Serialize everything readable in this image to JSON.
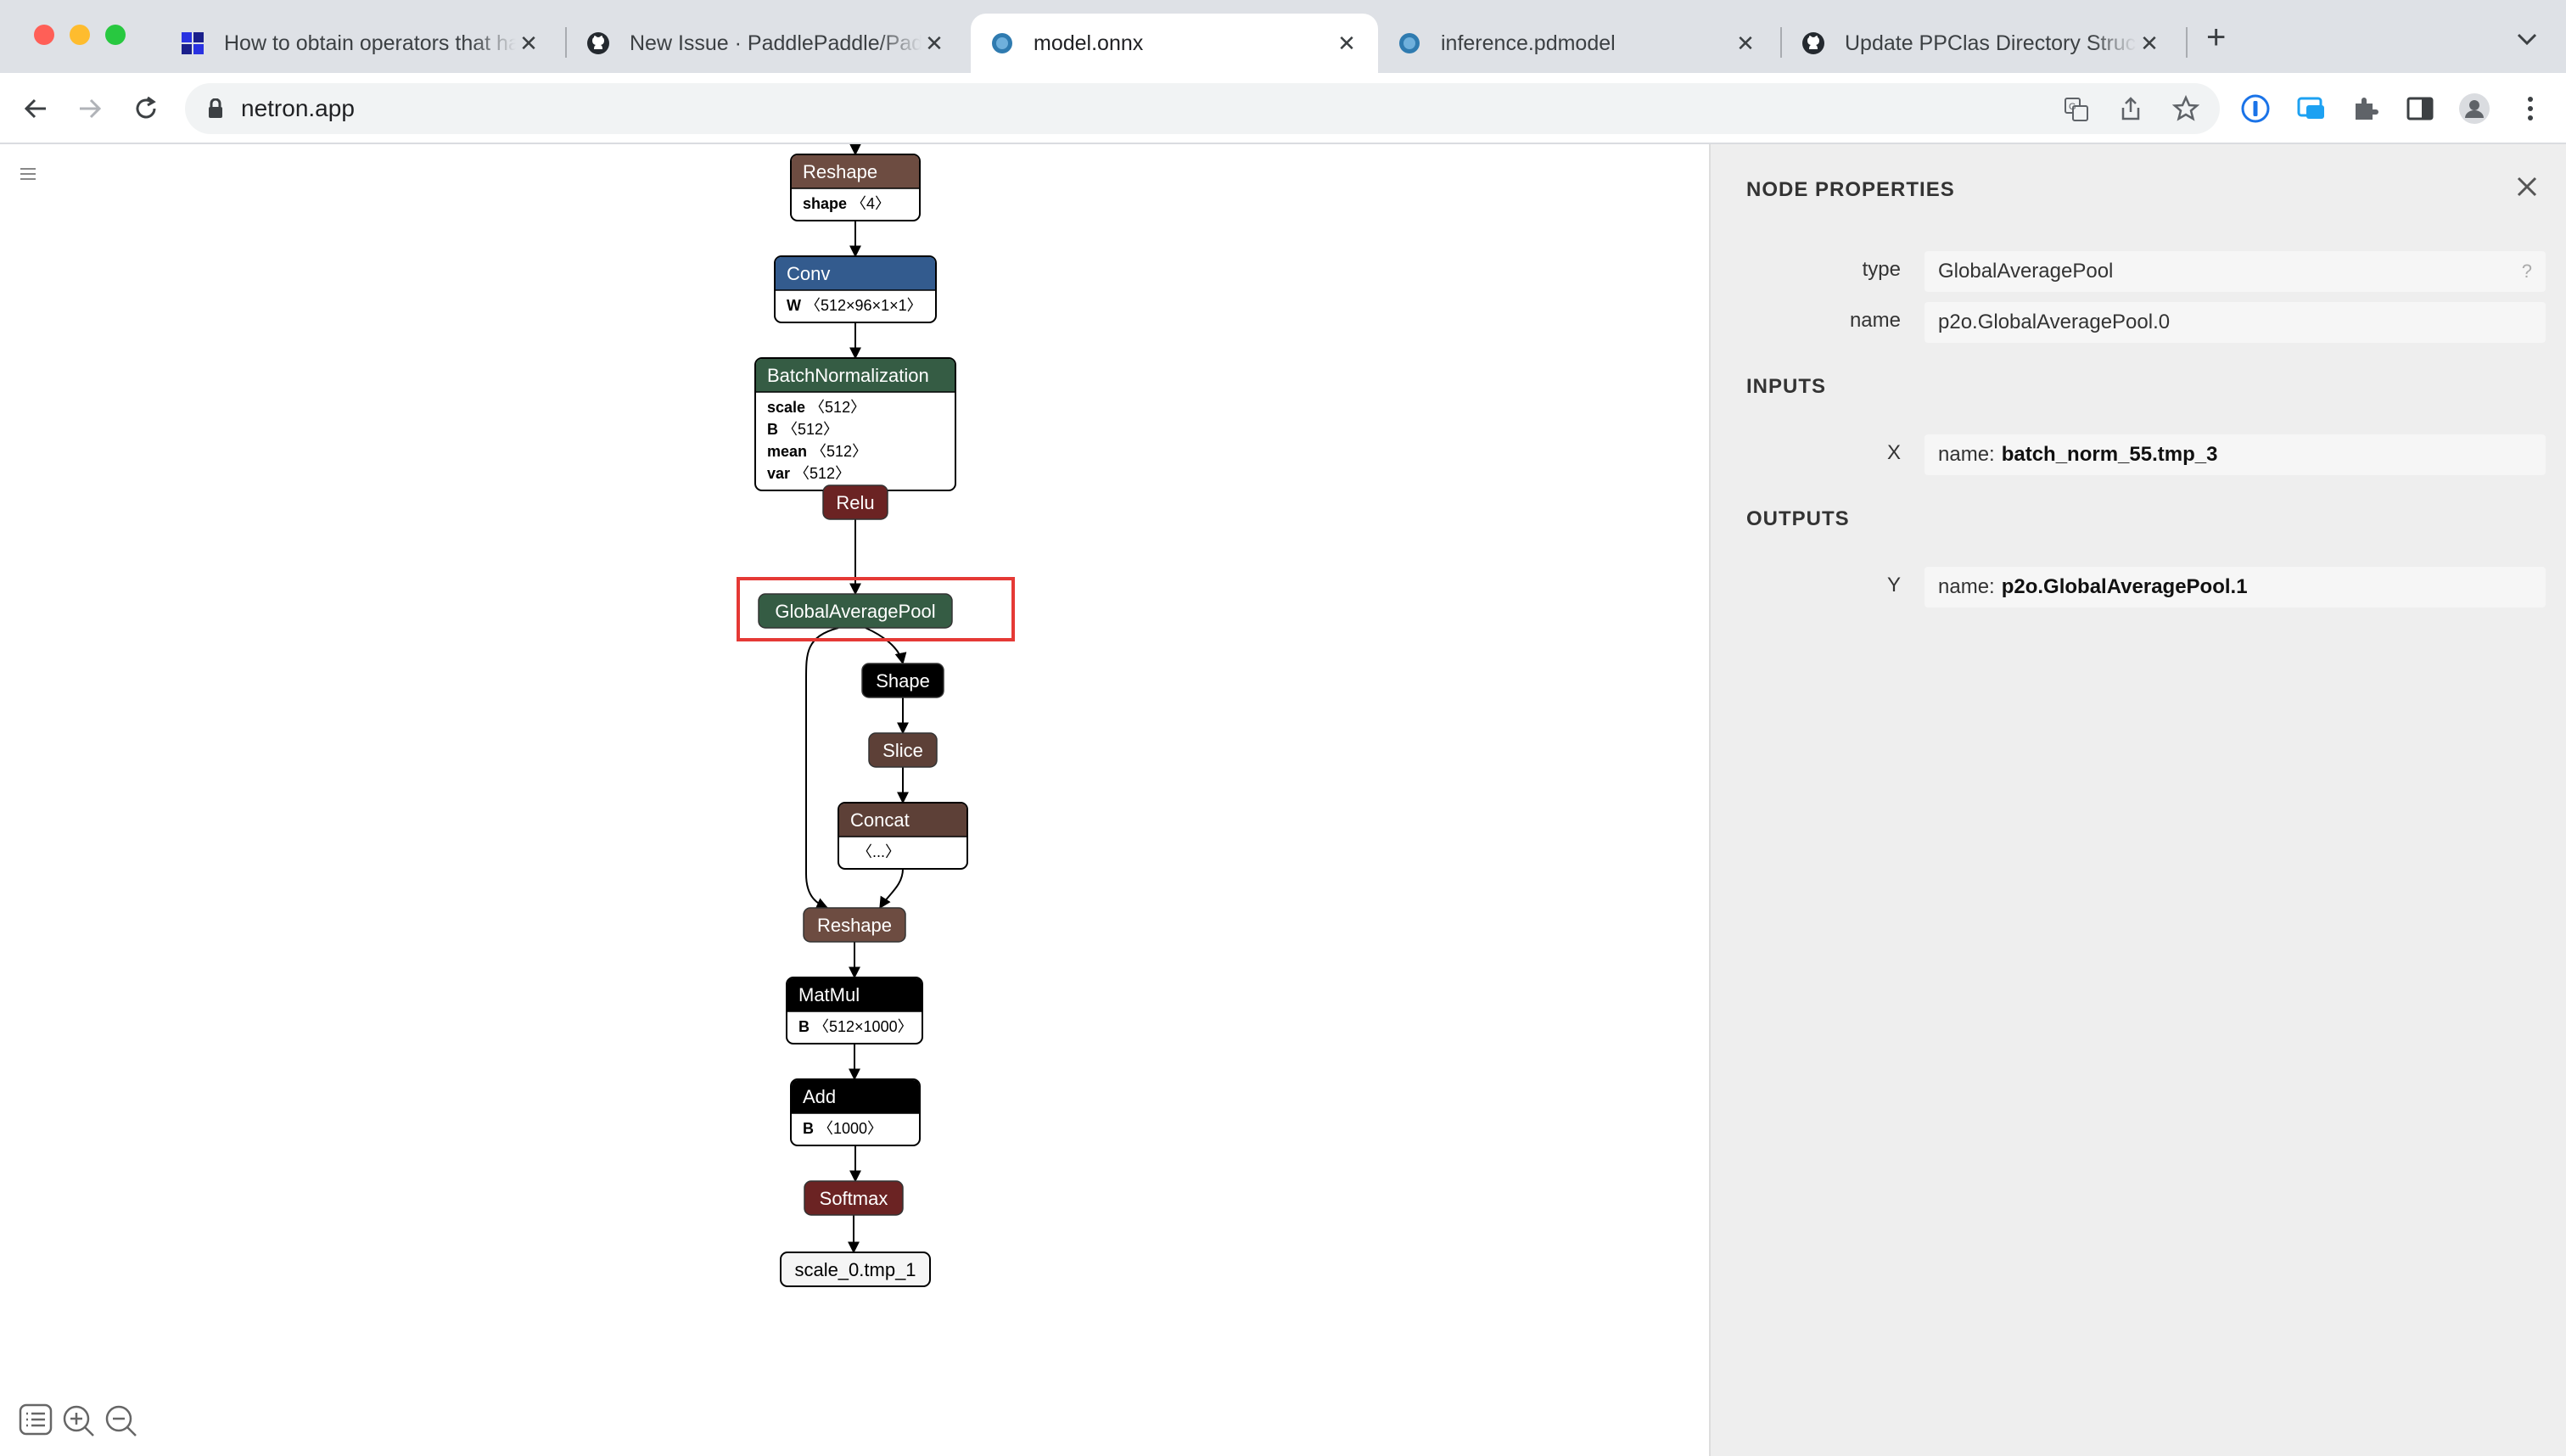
{
  "browser": {
    "tabs": [
      {
        "title": "How to obtain operators that have",
        "favicon": "paddle-icon"
      },
      {
        "title": "New Issue · PaddlePaddle/Paddle",
        "favicon": "github-icon"
      },
      {
        "title": "model.onnx",
        "favicon": "netron-icon",
        "active": true
      },
      {
        "title": "inference.pdmodel",
        "favicon": "netron-icon"
      },
      {
        "title": "Update PPClas Directory Structure",
        "favicon": "github-icon"
      }
    ],
    "tab_close": "✕",
    "new_tab": "+",
    "url": "netron.app"
  },
  "graph": {
    "nodes": [
      {
        "op": "Reshape",
        "color": "#6d4c41",
        "attrs": [
          {
            "name": "shape",
            "value": "〈4〉"
          }
        ]
      },
      {
        "op": "Conv",
        "color": "#335b8e",
        "attrs": [
          {
            "name": "W",
            "value": "〈512×96×1×1〉"
          }
        ]
      },
      {
        "op": "BatchNormalization",
        "color": "#355c44",
        "attrs": [
          {
            "name": "scale",
            "value": "〈512〉"
          },
          {
            "name": "B",
            "value": "〈512〉"
          },
          {
            "name": "mean",
            "value": "〈512〉"
          },
          {
            "name": "var",
            "value": "〈512〉"
          }
        ]
      },
      {
        "op": "Relu",
        "color": "#6b2323",
        "attrs": []
      },
      {
        "op": "GlobalAveragePool",
        "color": "#355c44",
        "attrs": [],
        "selected": true
      },
      {
        "op": "Shape",
        "color": "#000000",
        "attrs": []
      },
      {
        "op": "Slice",
        "color": "#5d4037",
        "attrs": []
      },
      {
        "op": "Concat",
        "color": "#5d4037",
        "attrs": [
          {
            "name": "",
            "value": "〈...〉"
          }
        ]
      },
      {
        "op": "Reshape",
        "color": "#6d4c41",
        "attrs": []
      },
      {
        "op": "MatMul",
        "color": "#000000",
        "attrs": [
          {
            "name": "B",
            "value": "〈512×1000〉"
          }
        ]
      },
      {
        "op": "Add",
        "color": "#000000",
        "attrs": [
          {
            "name": "B",
            "value": "〈1000〉"
          }
        ]
      },
      {
        "op": "Softmax",
        "color": "#6b2323",
        "attrs": []
      }
    ],
    "output": "scale_0.tmp_1"
  },
  "panel": {
    "title": "NODE PROPERTIES",
    "type_label": "type",
    "type_value": "GlobalAveragePool",
    "help": "?",
    "name_label": "name",
    "name_value": "p2o.GlobalAveragePool.0",
    "inputs_heading": "INPUTS",
    "input_label": "X",
    "input_prefix": "name:",
    "input_value": "batch_norm_55.tmp_3",
    "outputs_heading": "OUTPUTS",
    "output_label": "Y",
    "output_prefix": "name:",
    "output_value": "p2o.GlobalAveragePool.1"
  }
}
